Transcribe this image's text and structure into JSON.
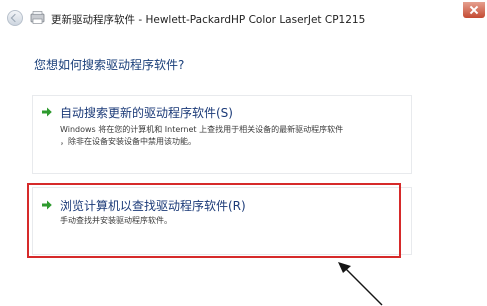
{
  "window": {
    "title": "更新驱动程序软件 - Hewlett-PackardHP Color LaserJet CP1215"
  },
  "heading": "您想如何搜索驱动程序软件?",
  "options": [
    {
      "title": "自动搜索更新的驱动程序软件(S)",
      "description_line1": "Windows 将在您的计算机和 Internet 上查找用于相关设备的最新驱动程序软件",
      "description_line2": "，除非在设备安装设备中禁用该功能。"
    },
    {
      "title": "浏览计算机以查找驱动程序软件(R)",
      "description_line1": "手动查找并安装驱动程序软件。"
    }
  ],
  "icons": {
    "back": "back-arrow-icon",
    "app": "device-manager-icon",
    "option_arrow": "green-arrow-icon",
    "close": "close-icon"
  },
  "colors": {
    "highlight": "#d62a2a",
    "option_arrow": "#2e9a2e",
    "heading": "#1a3f7a"
  }
}
